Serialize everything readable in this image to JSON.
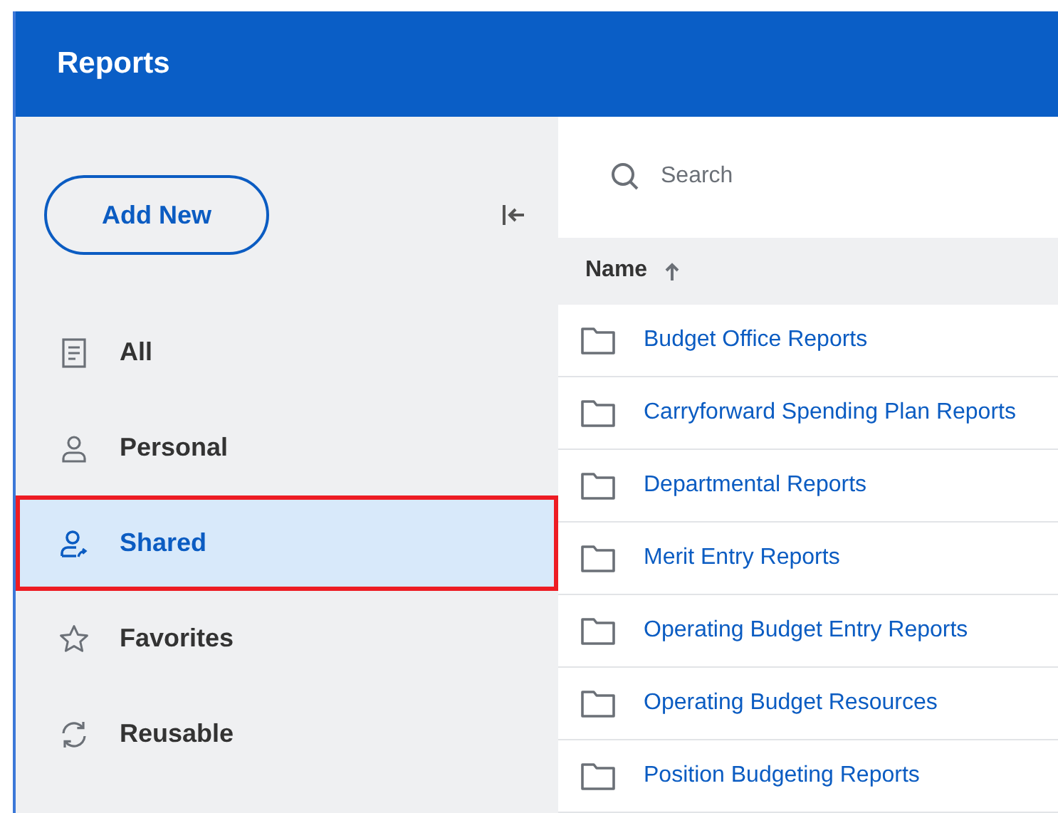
{
  "header": {
    "title": "Reports"
  },
  "sidebar": {
    "add_button": "Add New",
    "items": [
      {
        "label": "All",
        "kind": "document",
        "selected": false
      },
      {
        "label": "Personal",
        "kind": "person",
        "selected": false
      },
      {
        "label": "Shared",
        "kind": "shared",
        "selected": true
      },
      {
        "label": "Favorites",
        "kind": "star",
        "selected": false
      },
      {
        "label": "Reusable",
        "kind": "refresh",
        "selected": false
      }
    ]
  },
  "search": {
    "placeholder": "Search"
  },
  "table": {
    "columns": [
      {
        "label": "Name",
        "sorted": true
      }
    ],
    "rows": [
      "Budget Office Reports",
      "Carryforward Spending Plan Reports",
      "Departmental Reports",
      "Merit Entry Reports",
      "Operating Budget Entry Reports",
      "Operating Budget Resources",
      "Position Budgeting Reports"
    ]
  }
}
